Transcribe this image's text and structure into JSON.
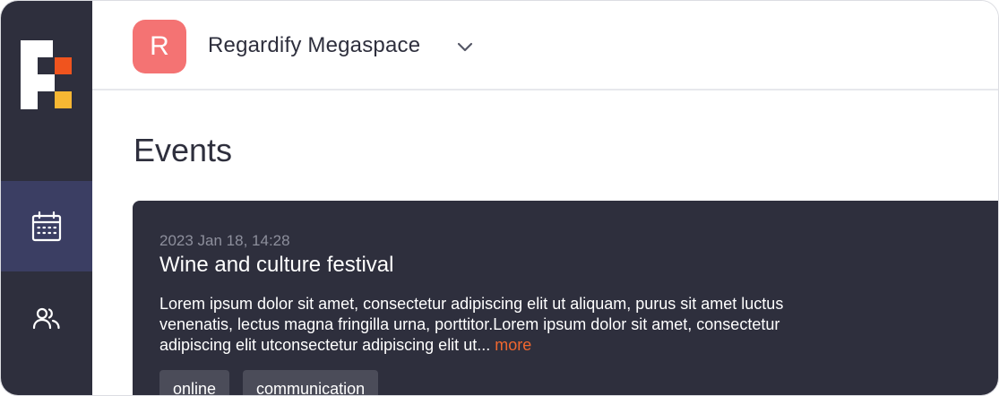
{
  "colors": {
    "sidebar_bg": "#2e2f3d",
    "sidebar_active": "#3b3e63",
    "workspace_avatar": "#f47373",
    "accent": "#f0672f",
    "card_bg": "#2e2f3d"
  },
  "sidebar": {
    "items": [
      {
        "icon": "calendar-icon",
        "active": true
      },
      {
        "icon": "users-icon",
        "active": false
      }
    ]
  },
  "header": {
    "workspace_initial": "R",
    "workspace_name": "Regardify Megaspace"
  },
  "main": {
    "title": "Events",
    "event": {
      "date": "2023 Jan 18, 14:28",
      "title": "Wine and culture festival",
      "description": "Lorem ipsum dolor sit amet, consectetur adipiscing elit ut aliquam, purus sit amet luctus venenatis, lectus magna fringilla urna, porttitor.Lorem ipsum dolor sit amet, consectetur adipiscing elit utconsectetur adipiscing elit ut...",
      "more_label": "more",
      "tags": [
        "online",
        "communication"
      ]
    }
  }
}
